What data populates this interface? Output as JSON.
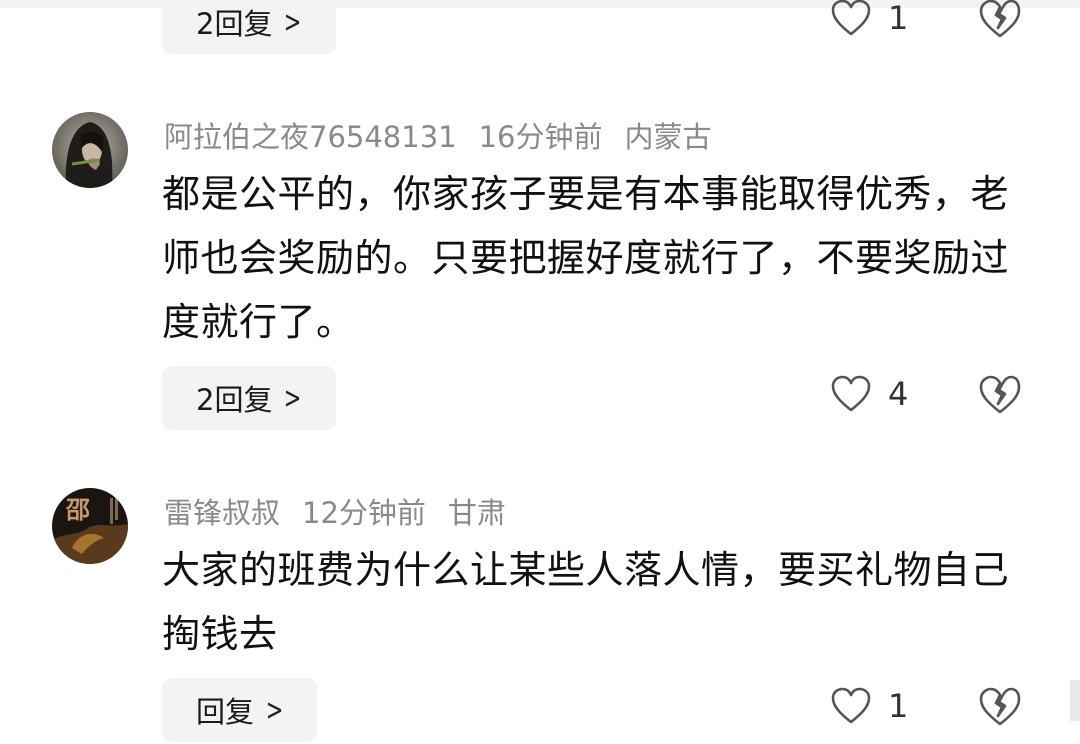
{
  "top_item": {
    "reply_label": "2回复",
    "like_count": "1"
  },
  "comments": [
    {
      "username": "阿拉伯之夜76548131",
      "time": "16分钟前",
      "location": "内蒙古",
      "text": "都是公平的，你家孩子要是有本事能取得优秀，老师也会奖励的。只要把握好度就行了，不要奖励过度就行了。",
      "reply_label": "2回复",
      "like_count": "4"
    },
    {
      "username": "雷锋叔叔",
      "time": "12分钟前",
      "location": "甘肃",
      "text": "大家的班费为什么让某些人落人情，要买礼物自己掏钱去",
      "reply_label": "回复",
      "like_count": "1"
    }
  ],
  "icons": {
    "like": "heart-outline-icon",
    "dislike": "broken-heart-icon",
    "reply_arrow": "chevron-right-icon"
  },
  "colors": {
    "meta_text": "#8a8a8a",
    "button_bg": "#f2f3f5",
    "body_text": "#111111"
  }
}
